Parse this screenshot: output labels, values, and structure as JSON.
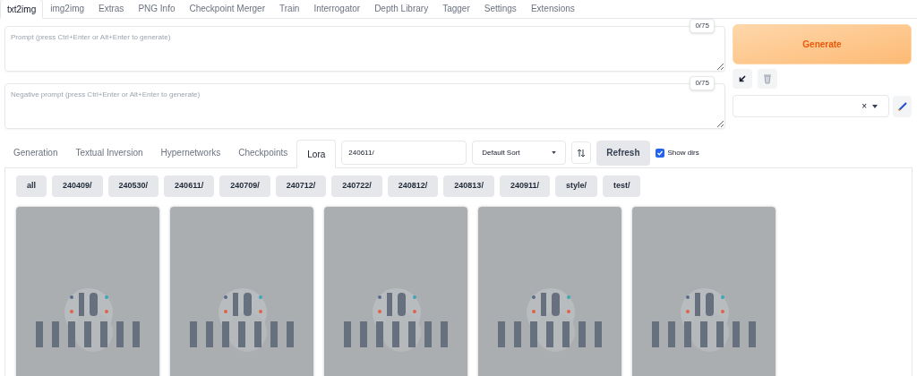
{
  "tabs": [
    {
      "label": "txt2img",
      "selected": true
    },
    {
      "label": "img2img",
      "selected": false
    },
    {
      "label": "Extras",
      "selected": false
    },
    {
      "label": "PNG Info",
      "selected": false
    },
    {
      "label": "Checkpoint Merger",
      "selected": false
    },
    {
      "label": "Train",
      "selected": false
    },
    {
      "label": "Interrogator",
      "selected": false
    },
    {
      "label": "Depth Library",
      "selected": false
    },
    {
      "label": "Tagger",
      "selected": false
    },
    {
      "label": "Settings",
      "selected": false
    },
    {
      "label": "Extensions",
      "selected": false
    }
  ],
  "prompt": {
    "placeholder": "Prompt (press Ctrl+Enter or Alt+Enter to generate)",
    "token_count": "0/75"
  },
  "negative_prompt": {
    "placeholder": "Negative prompt (press Ctrl+Enter or Alt+Enter to generate)",
    "token_count": "0/75"
  },
  "generate_button": "Generate",
  "clear_icon": "×",
  "network_tabs": [
    {
      "label": "Generation",
      "selected": false
    },
    {
      "label": "Textual Inversion",
      "selected": false
    },
    {
      "label": "Hypernetworks",
      "selected": false
    },
    {
      "label": "Checkpoints",
      "selected": false
    },
    {
      "label": "Lora",
      "selected": true
    }
  ],
  "search": {
    "value": "240611/"
  },
  "sort": {
    "value": "Default Sort"
  },
  "refresh_button": "Refresh",
  "show_dirs": {
    "label": "Show dirs",
    "checked": true
  },
  "dir_buttons": [
    "all",
    "240409/",
    "240530/",
    "240611/",
    "240709/",
    "240712/",
    "240722/",
    "240812/",
    "240813/",
    "240911/",
    "style/",
    "test/"
  ]
}
